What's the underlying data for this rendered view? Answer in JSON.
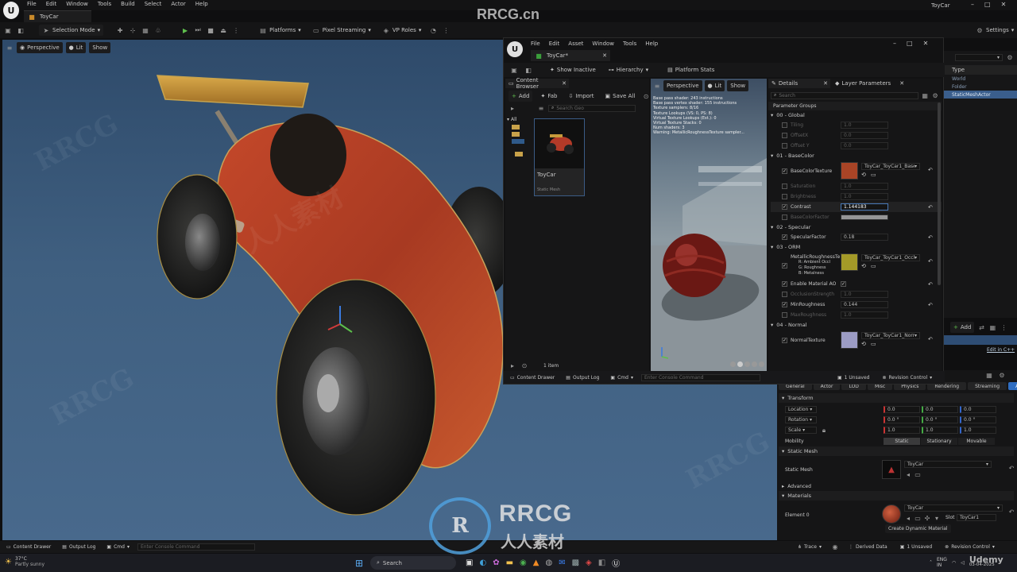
{
  "main": {
    "menu": [
      "File",
      "Edit",
      "Window",
      "Tools",
      "Build",
      "Select",
      "Actor",
      "Help"
    ],
    "window_title": "ToyCar",
    "doc_tab": "ToyCar",
    "toolbar": {
      "selection_mode": "Selection Mode",
      "platforms": "Platforms",
      "pixel_streaming": "Pixel Streaming",
      "vp_roles": "VP Roles",
      "settings": "Settings"
    },
    "viewport": {
      "perspective": "Perspective",
      "lit": "Lit",
      "show": "Show"
    }
  },
  "watermark_top": "RRCG.cn",
  "editor": {
    "menu": [
      "File",
      "Edit",
      "Asset",
      "Window",
      "Tools",
      "Help"
    ],
    "tab": "ToyCar*",
    "toolbar": {
      "show_inactive": "Show Inactive",
      "hierarchy": "Hierarchy",
      "platform_stats": "Platform Stats"
    },
    "content_browser": {
      "title": "Content Browser",
      "add": "Add",
      "fab": "Fab",
      "import": "Import",
      "save_all": "Save All",
      "search_placeholder": "Search Geo",
      "tree_all": "All",
      "asset_name": "ToyCar",
      "asset_type": "Static Mesh",
      "count": "1 item"
    },
    "preview": {
      "perspective": "Perspective",
      "lit": "Lit",
      "show": "Show",
      "stats": [
        "Base pass shader: 243 instructions",
        "Base pass vertex shader: 155 instructions",
        "Texture samplers: 8/16",
        "Texture Lookups (VS: 0, PS: 8)",
        "Virtual Texture Lookups (Est.): 0",
        "Virtual Texture Stacks: 0",
        "Num shaders: 3",
        "Warning: MetallicRoughnessTexture sampler..."
      ]
    },
    "details": {
      "title": "Details",
      "layer_tab": "Layer Parameters",
      "search_placeholder": "Search",
      "param_groups": "Parameter Groups",
      "groups": [
        {
          "name": "00 - Global",
          "props": [
            {
              "name": "Tiling",
              "value": "1.0",
              "checked": false,
              "dim": true
            },
            {
              "name": "OffsetX",
              "value": "0.0",
              "checked": false,
              "dim": true
            },
            {
              "name": "Offset Y",
              "value": "0.0",
              "checked": false,
              "dim": true
            }
          ]
        },
        {
          "name": "01 - BaseColor",
          "props": [
            {
              "name": "BaseColorTexture",
              "value": "ToyCar_ToyCar1_BaseC",
              "checked": true,
              "dim": false,
              "texture": "#a94426"
            },
            {
              "name": "Saturation",
              "value": "1.0",
              "checked": false,
              "dim": true
            },
            {
              "name": "Brightness",
              "value": "1.0",
              "checked": false,
              "dim": true
            },
            {
              "name": "Contrast",
              "value": "1.144183",
              "checked": true,
              "dim": false,
              "highlight": true
            },
            {
              "name": "BaseColorFactor",
              "value": "",
              "checked": false,
              "dim": true,
              "swatch": true
            }
          ]
        },
        {
          "name": "02 - Specular",
          "props": [
            {
              "name": "SpecularFactor",
              "value": "0.18",
              "checked": true,
              "dim": false
            }
          ]
        },
        {
          "name": "03 - ORM",
          "props": [
            {
              "name": "MetallicRoughnessTe",
              "value": "ToyCar_ToyCar1_Occlu",
              "checked": true,
              "dim": false,
              "texture": "#a49a28",
              "channels": [
                "R: Ambient Occl",
                "G: Roughness",
                "B: Metalness"
              ]
            },
            {
              "name": "Enable Material AO",
              "value": "",
              "checked": true,
              "dim": false,
              "bool": true
            },
            {
              "name": "OcclusionStrength",
              "value": "1.0",
              "checked": false,
              "dim": true
            },
            {
              "name": "MinRoughness",
              "value": "0.144",
              "checked": true,
              "dim": false
            },
            {
              "name": "MaxRoughness",
              "value": "1.0",
              "checked": false,
              "dim": true
            }
          ]
        },
        {
          "name": "04 - Normal",
          "props": [
            {
              "name": "NormalTexture",
              "value": "ToyCar_ToyCar1_Norm",
              "checked": true,
              "dim": false,
              "texture": "#9c9cc4"
            }
          ]
        }
      ]
    },
    "bottom": {
      "content_drawer": "Content Drawer",
      "output_log": "Output Log",
      "cmd": "Cmd",
      "console_placeholder": "Enter Console Command",
      "unsaved": "1 Unsaved",
      "revision": "Revision Control"
    }
  },
  "outliner": {
    "type_header": "Type",
    "types": [
      "World",
      "Folder",
      "StaticMeshActor"
    ]
  },
  "level_details": {
    "add": "Add",
    "edit_cpp": "Edit in C++",
    "tabs": [
      "General",
      "Actor",
      "LOD",
      "Misc",
      "Physics",
      "Rendering",
      "Streaming",
      "All"
    ],
    "transform": "Transform",
    "location": "Location",
    "rotation": "Rotation",
    "scale": "Scale",
    "loc_vals": [
      "0.0",
      "0.0",
      "0.0"
    ],
    "rot_vals": [
      "0.0 °",
      "0.0 °",
      "0.0 °"
    ],
    "scale_vals": [
      "1.0",
      "1.0",
      "1.0"
    ],
    "mobility": "Mobility",
    "mobility_opts": [
      "Static",
      "Stationary",
      "Movable"
    ],
    "static_mesh_section": "Static Mesh",
    "static_mesh_label": "Static Mesh",
    "static_mesh_value": "ToyCar",
    "advanced": "Advanced",
    "materials": "Materials",
    "element0": "Element 0",
    "element0_value": "ToyCar",
    "slot_label": "Slot",
    "slot_value": "ToyCar1",
    "create_dynamic": "Create Dynamic Material"
  },
  "statusbar": {
    "content_drawer": "Content Drawer",
    "output_log": "Output Log",
    "cmd": "Cmd",
    "console_placeholder": "Enter Console Command",
    "trace": "Trace",
    "derived_data": "Derived Data",
    "unsaved": "1 Unsaved",
    "revision": "Revision Control"
  },
  "taskbar": {
    "temp": "37°C",
    "weather": "Partly sunny",
    "search_placeholder": "Search",
    "lang1": "ENG",
    "lang2": "IN",
    "date": "03-04-2025"
  },
  "logo": {
    "big": "RRCG",
    "sub": "人人素材"
  },
  "udemy": "Udemy",
  "colors": {
    "accent": "#2f6ec2",
    "panel": "#1a1a1b",
    "selection": "#3a5e8c"
  }
}
